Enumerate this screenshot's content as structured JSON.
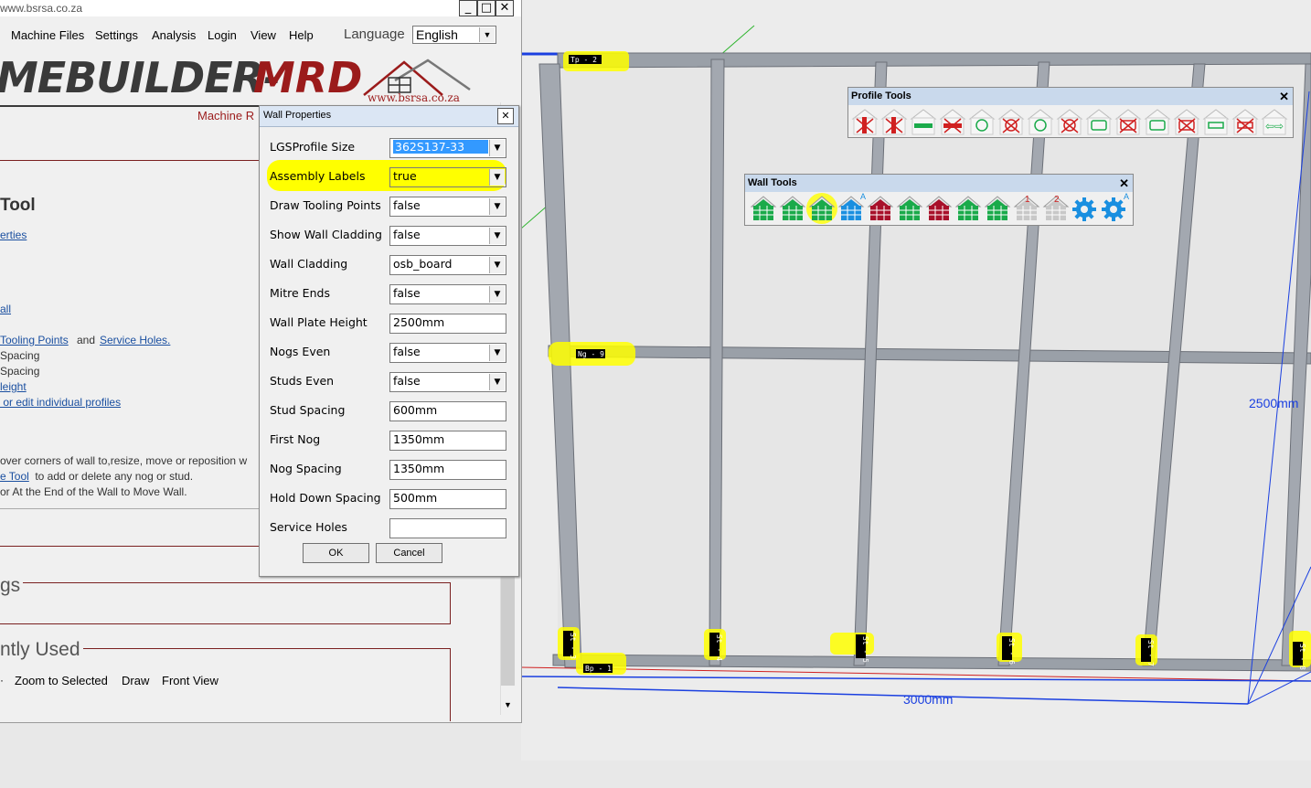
{
  "window": {
    "title": "www.bsrsa.co.za",
    "min_glyph": "_",
    "max_glyph": "□",
    "close_glyph": "✕"
  },
  "menu": {
    "items": [
      "Machine Files",
      "Settings",
      "Analysis",
      "Login",
      "View",
      "Help"
    ],
    "language_label": "Language",
    "language_value": "English"
  },
  "logo": {
    "text_a": "MEBUILDER-",
    "text_b": "MRD",
    "sub": "Machine R",
    "url": "www.bsrsa.co.za"
  },
  "left_panel": {
    "tool_heading": "Tool",
    "link_properties": "erties",
    "link_wall": "all",
    "link_tooling": "Tooling Points",
    "and_text": "and",
    "link_service": "Service Holes.",
    "spacing1": "Spacing",
    "spacing2": "Spacing",
    "link_height": "leight",
    "link_edit": " or edit individual profiles",
    "info1": "over corners of wall to,resize, move or reposition w",
    "info2_link": "e Tool",
    "info2_rest": " to add or delete any nog or stud.",
    "info3": "or At the End of the Wall to Move Wall.",
    "settings_heading": "gs",
    "recent_heading": "ntly Used",
    "recent_items": [
      "Zoom to Selected",
      "Draw",
      "Front View"
    ]
  },
  "dialog": {
    "title": "Wall Properties",
    "close_glyph": "✕",
    "properties": [
      {
        "label": "LGSProfile Size",
        "value": "362S137-33",
        "dropdown": true,
        "selected": true
      },
      {
        "label": "Assembly Labels",
        "value": "true",
        "dropdown": true,
        "highlight": true
      },
      {
        "label": "Draw Tooling Points",
        "value": "false",
        "dropdown": true
      },
      {
        "label": "Show Wall Cladding",
        "value": "false",
        "dropdown": true
      },
      {
        "label": "Wall Cladding",
        "value": "osb_board",
        "dropdown": true
      },
      {
        "label": "Mitre Ends",
        "value": "false",
        "dropdown": true
      },
      {
        "label": "Wall Plate Height",
        "value": "2500mm",
        "dropdown": false
      },
      {
        "label": "Nogs Even",
        "value": "false",
        "dropdown": true
      },
      {
        "label": "Studs Even",
        "value": "false",
        "dropdown": true
      },
      {
        "label": "Stud Spacing",
        "value": "600mm",
        "dropdown": false
      },
      {
        "label": "First Nog",
        "value": "1350mm",
        "dropdown": false
      },
      {
        "label": "Nog Spacing",
        "value": "1350mm",
        "dropdown": false
      },
      {
        "label": "Hold Down Spacing",
        "value": "500mm",
        "dropdown": false
      },
      {
        "label": "Service Holes",
        "value": "",
        "dropdown": false
      }
    ],
    "ok_label": "OK",
    "cancel_label": "Cancel"
  },
  "profile_tools": {
    "title": "Profile Tools",
    "close_glyph": "✕",
    "icons": [
      "stud-delete-icon",
      "stud-add-icon",
      "nog-add-icon",
      "nog-delete-icon",
      "service-hole-icon",
      "service-hole-delete-icon",
      "round-hole-icon",
      "round-hole-delete-icon",
      "rect-hole-icon",
      "rect-hole-delete-icon",
      "slot-icon",
      "slot-delete-icon",
      "dimple-icon",
      "dimple-delete-icon",
      "move-arrows-icon"
    ]
  },
  "wall_tools": {
    "title": "Wall Tools",
    "close_glyph": "✕",
    "icons": [
      "wall-green-icon",
      "wall-green-2-icon",
      "wall-green-selected-icon",
      "wall-blue-icon",
      "wall-red-icon",
      "wall-green-3-icon",
      "wall-red-2-icon",
      "wall-panel-icon",
      "wall-panel-2-icon",
      "wall-grid-1-icon",
      "wall-grid-2-icon",
      "settings-gear-icon",
      "settings-gear-a-icon"
    ],
    "grid_numbers": [
      "1",
      "2"
    ],
    "gear_badge": "A",
    "house_badge": "A"
  },
  "viewport": {
    "labels": [
      "Tp - 2",
      "Ng - 9",
      "Bp - 1",
      "St - 3",
      "St - 4",
      "St - 5",
      "St - 6",
      "St - 7",
      "St - 8"
    ],
    "dim_width": "3000mm",
    "dim_height": "2500mm"
  },
  "colors": {
    "highlight": "#ffff00",
    "link": "#1a4fa0",
    "logo_dark": "#3a3a3a",
    "logo_red": "#9b1b1b",
    "dim_blue": "#1a3fe0"
  }
}
